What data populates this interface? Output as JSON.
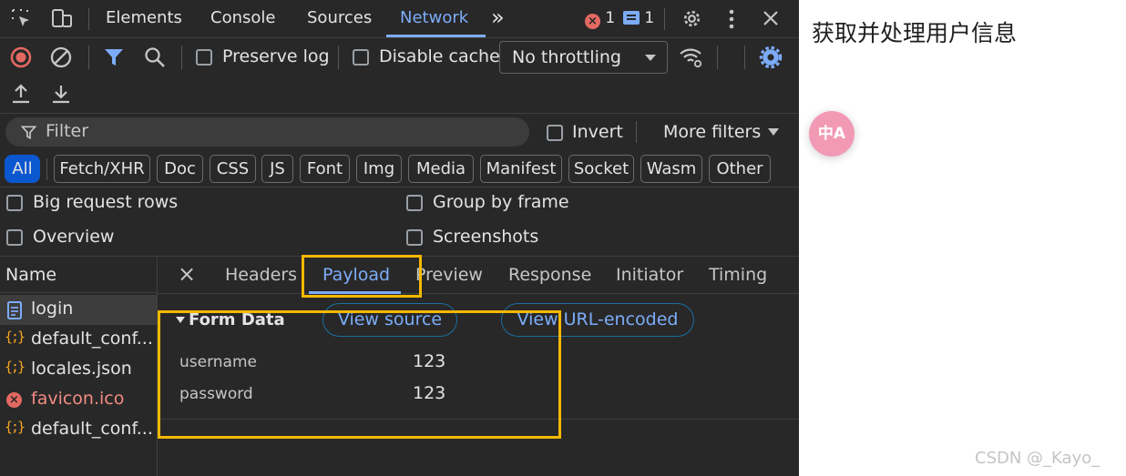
{
  "toolbar_tabs": {
    "elements": "Elements",
    "console": "Console",
    "sources": "Sources",
    "network": "Network",
    "more": "»",
    "error_count": "1",
    "message_count": "1"
  },
  "network_toolbar": {
    "preserve_log": "Preserve log",
    "disable_cache": "Disable cache",
    "throttling": "No throttling"
  },
  "filter": {
    "placeholder": "Filter",
    "invert": "Invert",
    "more_filters": "More filters"
  },
  "type_filters": [
    "All",
    "Fetch/XHR",
    "Doc",
    "CSS",
    "JS",
    "Font",
    "Img",
    "Media",
    "Manifest",
    "Socket",
    "Wasm",
    "Other"
  ],
  "options": {
    "big_request_rows": "Big request rows",
    "group_by_frame": "Group by frame",
    "overview": "Overview",
    "screenshots": "Screenshots"
  },
  "request_list": {
    "header": "Name",
    "items": [
      {
        "name": "login",
        "icon": "document-icon",
        "status": "selected"
      },
      {
        "name": "default_conf...",
        "icon": "json-icon",
        "status": "ok"
      },
      {
        "name": "locales.json",
        "icon": "json-icon",
        "status": "ok"
      },
      {
        "name": "favicon.ico",
        "icon": "error-icon",
        "status": "error"
      },
      {
        "name": "default_conf...",
        "icon": "json-icon",
        "status": "ok"
      }
    ]
  },
  "detail_tabs": {
    "close": "×",
    "headers": "Headers",
    "payload": "Payload",
    "preview": "Preview",
    "response": "Response",
    "initiator": "Initiator",
    "timing": "Timing"
  },
  "payload": {
    "section_title": "Form Data",
    "view_source": "View source",
    "view_url_encoded": "View URL-encoded",
    "fields": [
      {
        "key": "username",
        "value": "123"
      },
      {
        "key": "password",
        "value": "123"
      }
    ]
  },
  "page": {
    "title": "获取并处理用户信息",
    "translate_icon": "中A"
  },
  "watermark": "CSDN @_Kayo_",
  "colors": {
    "devtools_bg": "#282828",
    "accent_blue": "#7cacf8",
    "highlight": "#f5b800",
    "error_red": "#e46962",
    "translate_pink": "#f29ab5"
  }
}
